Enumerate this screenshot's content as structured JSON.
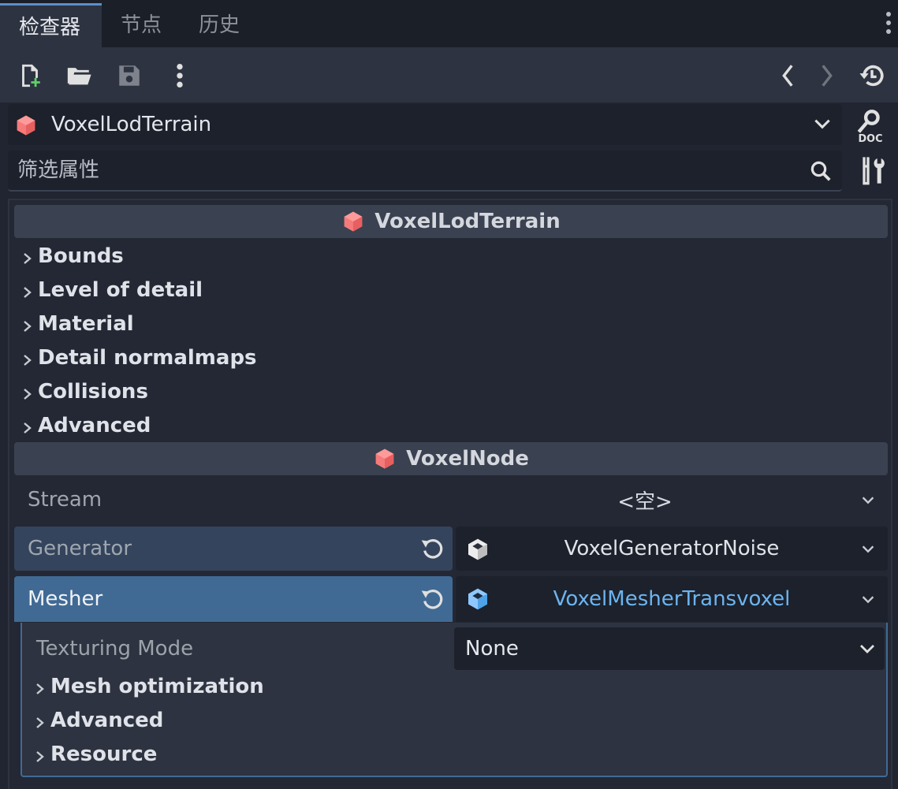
{
  "tabs": [
    {
      "label": "检查器",
      "active": true
    },
    {
      "label": "节点",
      "active": false
    },
    {
      "label": "历史",
      "active": false
    }
  ],
  "object_selector": {
    "name": "VoxelLodTerrain"
  },
  "filter": {
    "placeholder": "筛选属性"
  },
  "sections": [
    {
      "title": "VoxelLodTerrain",
      "groups": [
        "Bounds",
        "Level of detail",
        "Material",
        "Detail normalmaps",
        "Collisions",
        "Advanced"
      ]
    },
    {
      "title": "VoxelNode"
    }
  ],
  "properties": {
    "stream": {
      "label": "Stream",
      "value": "<空>"
    },
    "generator": {
      "label": "Generator",
      "value": "VoxelGeneratorNoise"
    },
    "mesher": {
      "label": "Mesher",
      "value": "VoxelMesherTransvoxel"
    }
  },
  "mesher_sub": {
    "texturing_mode": {
      "label": "Texturing Mode",
      "value": "None"
    },
    "groups": [
      "Mesh optimization",
      "Advanced",
      "Resource"
    ]
  },
  "colors": {
    "accent": "#406a94",
    "resource_link": "#6cb4f0",
    "cube_red": "#f07878"
  }
}
